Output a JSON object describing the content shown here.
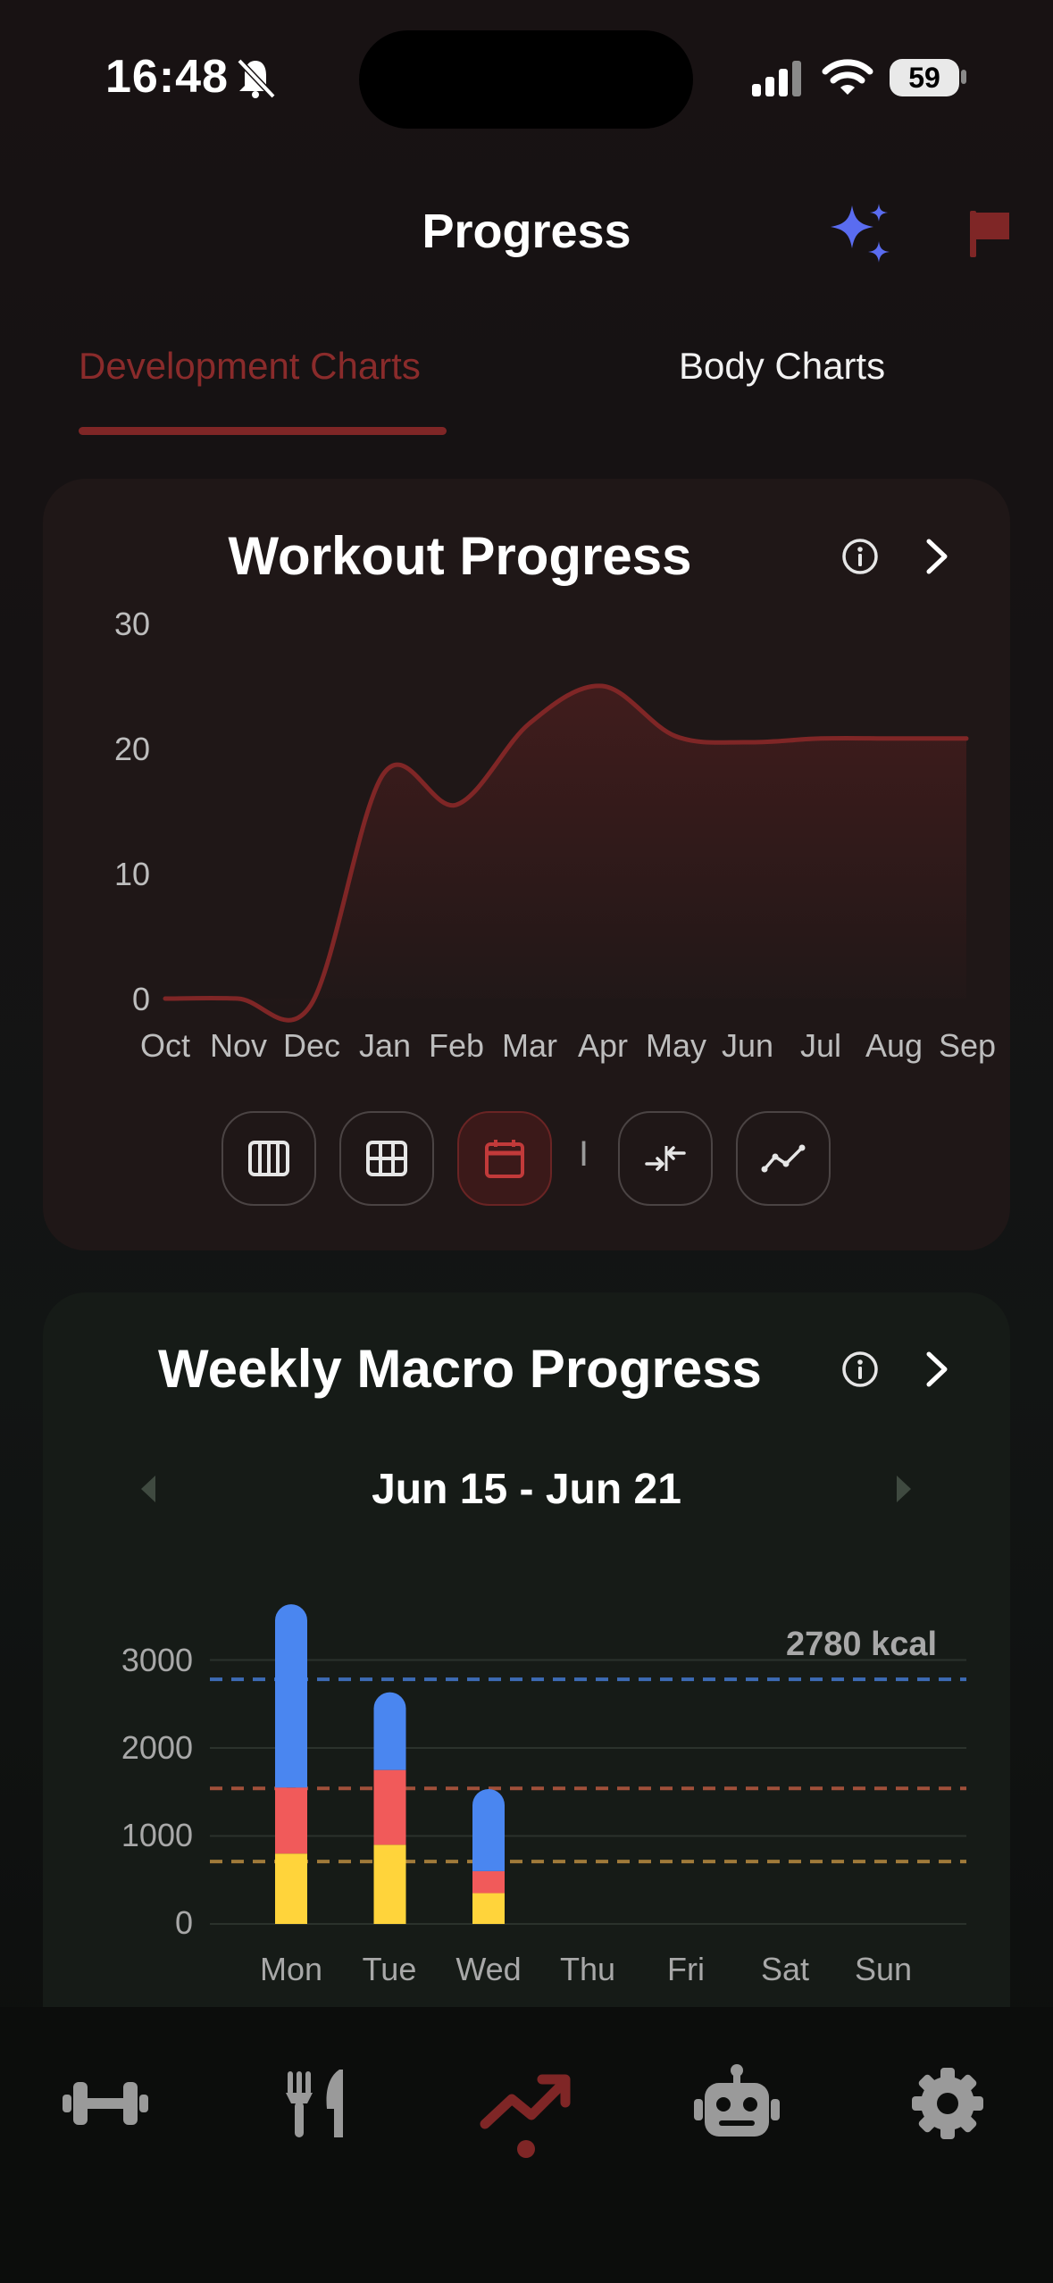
{
  "status_bar": {
    "time": "16:48",
    "battery": "59"
  },
  "header": {
    "title": "Progress"
  },
  "tabs": [
    {
      "label": "Development Charts",
      "active": true
    },
    {
      "label": "Body Charts",
      "active": false
    }
  ],
  "workout_card": {
    "title": "Workout Progress",
    "y_ticks": [
      "30",
      "20",
      "10",
      "0"
    ],
    "x_ticks": [
      "Oct",
      "Nov",
      "Dec",
      "Jan",
      "Feb",
      "Mar",
      "Apr",
      "May",
      "Jun",
      "Jul",
      "Aug",
      "Sep"
    ],
    "separator": "I",
    "controls": [
      "columns-view",
      "grid-view",
      "calendar-view",
      "compare",
      "trend-line"
    ]
  },
  "macro_card": {
    "title": "Weekly Macro Progress",
    "date_range": "Jun 15 - Jun 21",
    "y_ticks": [
      "3000",
      "2000",
      "1000",
      "0"
    ],
    "x_ticks": [
      "Mon",
      "Tue",
      "Wed",
      "Thu",
      "Fri",
      "Sat",
      "Sun"
    ],
    "target_label": "2780 kcal"
  },
  "nav": [
    {
      "icon": "dumbbell-icon",
      "active": false
    },
    {
      "icon": "fork-knife-icon",
      "active": false
    },
    {
      "icon": "trending-up-icon",
      "active": true
    },
    {
      "icon": "robot-icon",
      "active": false
    },
    {
      "icon": "gear-icon",
      "active": false
    }
  ],
  "colors": {
    "accent": "#7f2626",
    "protein": "#4a86f0",
    "carbs": "#f15a5a",
    "fat": "#ffd43b",
    "sparkle": "#5a6cf0"
  },
  "chart_data": [
    {
      "type": "line",
      "title": "Workout Progress",
      "x": [
        "Oct",
        "Nov",
        "Dec",
        "Jan",
        "Feb",
        "Mar",
        "Apr",
        "May",
        "Jun",
        "Jul",
        "Aug",
        "Sep"
      ],
      "values": [
        0,
        0,
        -0.5,
        18,
        15.5,
        22,
        25,
        21,
        20.5,
        20.8,
        20.8,
        20.8
      ],
      "ylim": [
        0,
        30
      ]
    },
    {
      "type": "bar",
      "title": "Weekly Macro Progress",
      "categories": [
        "Mon",
        "Tue",
        "Wed",
        "Thu",
        "Fri",
        "Sat",
        "Sun"
      ],
      "series": [
        {
          "values": [
            800,
            900,
            350,
            0,
            0,
            0,
            0
          ]
        },
        {
          "values": [
            750,
            850,
            250,
            0,
            0,
            0,
            0
          ]
        },
        {
          "values": [
            1900,
            700,
            750,
            0,
            0,
            0,
            0
          ]
        }
      ],
      "reference_lines": [
        2780,
        1540,
        710
      ],
      "ylim": [
        0,
        3500
      ]
    }
  ]
}
